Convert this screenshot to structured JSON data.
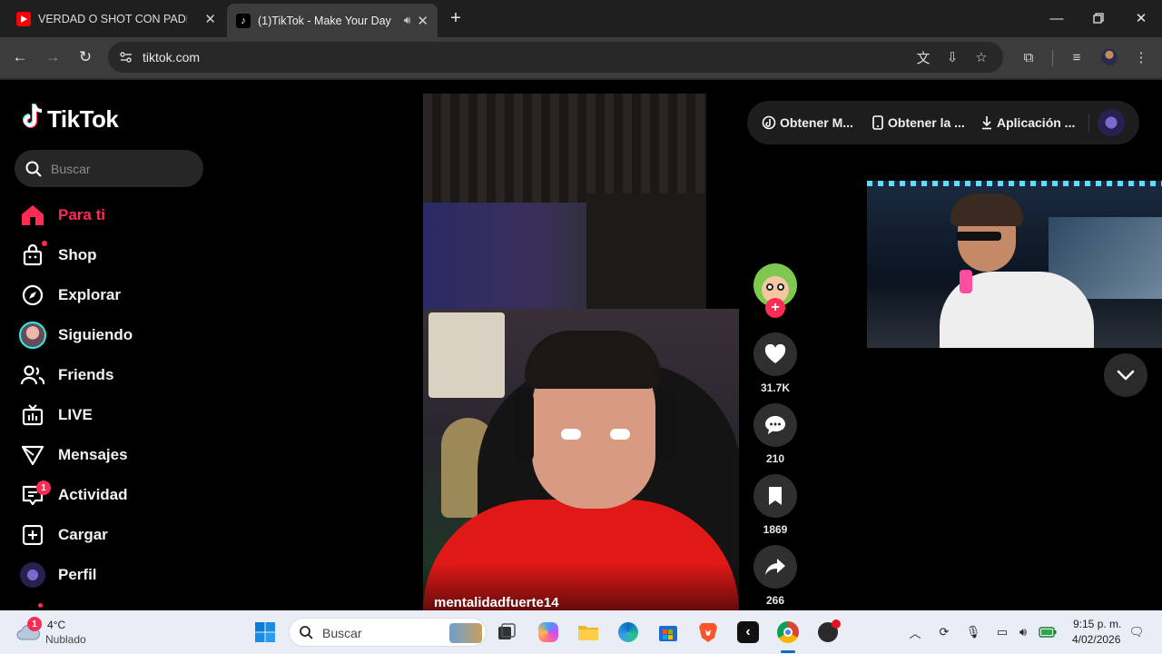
{
  "browser": {
    "tabs": [
      {
        "title": "VERDAD O SHOT CON PADRES",
        "active": false
      },
      {
        "title": "(1)TikTok - Make Your Day",
        "active": true
      }
    ],
    "url": "tiktok.com"
  },
  "tiktok": {
    "logo_text": "TikTok",
    "search_placeholder": "Buscar",
    "nav": [
      {
        "label": "Para ti",
        "icon": "home-icon",
        "active": true
      },
      {
        "label": "Shop",
        "icon": "shop-bag-icon"
      },
      {
        "label": "Explorar",
        "icon": "compass-icon"
      },
      {
        "label": "Siguiendo",
        "icon": "avatar-icon"
      },
      {
        "label": "Friends",
        "icon": "friends-icon"
      },
      {
        "label": "LIVE",
        "icon": "live-tv-icon"
      },
      {
        "label": "Mensajes",
        "icon": "send-icon"
      },
      {
        "label": "Actividad",
        "icon": "activity-icon",
        "badge": "1"
      },
      {
        "label": "Cargar",
        "icon": "upload-plus-icon"
      },
      {
        "label": "Perfil",
        "icon": "profile-avatar-icon"
      }
    ],
    "top_links": [
      {
        "label": "Obtener M...",
        "icon": "coin-icon"
      },
      {
        "label": "Obtener la ...",
        "icon": "phone-icon"
      },
      {
        "label": "Aplicación ...",
        "icon": "download-icon"
      }
    ],
    "video": {
      "username": "mentalidadfuerte14",
      "likes": "31.7K",
      "comments": "210",
      "saves": "1869",
      "shares": "266"
    }
  },
  "taskbar": {
    "weather_temp": "4°C",
    "weather_desc": "Nublado",
    "weather_badge": "1",
    "search_placeholder": "Buscar",
    "time": "9:15 p. m.",
    "date": "4/02/2026"
  },
  "colors": {
    "accent": "#fe2c55",
    "chrome_dark": "#1f1f1f",
    "toolbar": "#3c3c3c",
    "taskbar": "#e9eef6"
  }
}
